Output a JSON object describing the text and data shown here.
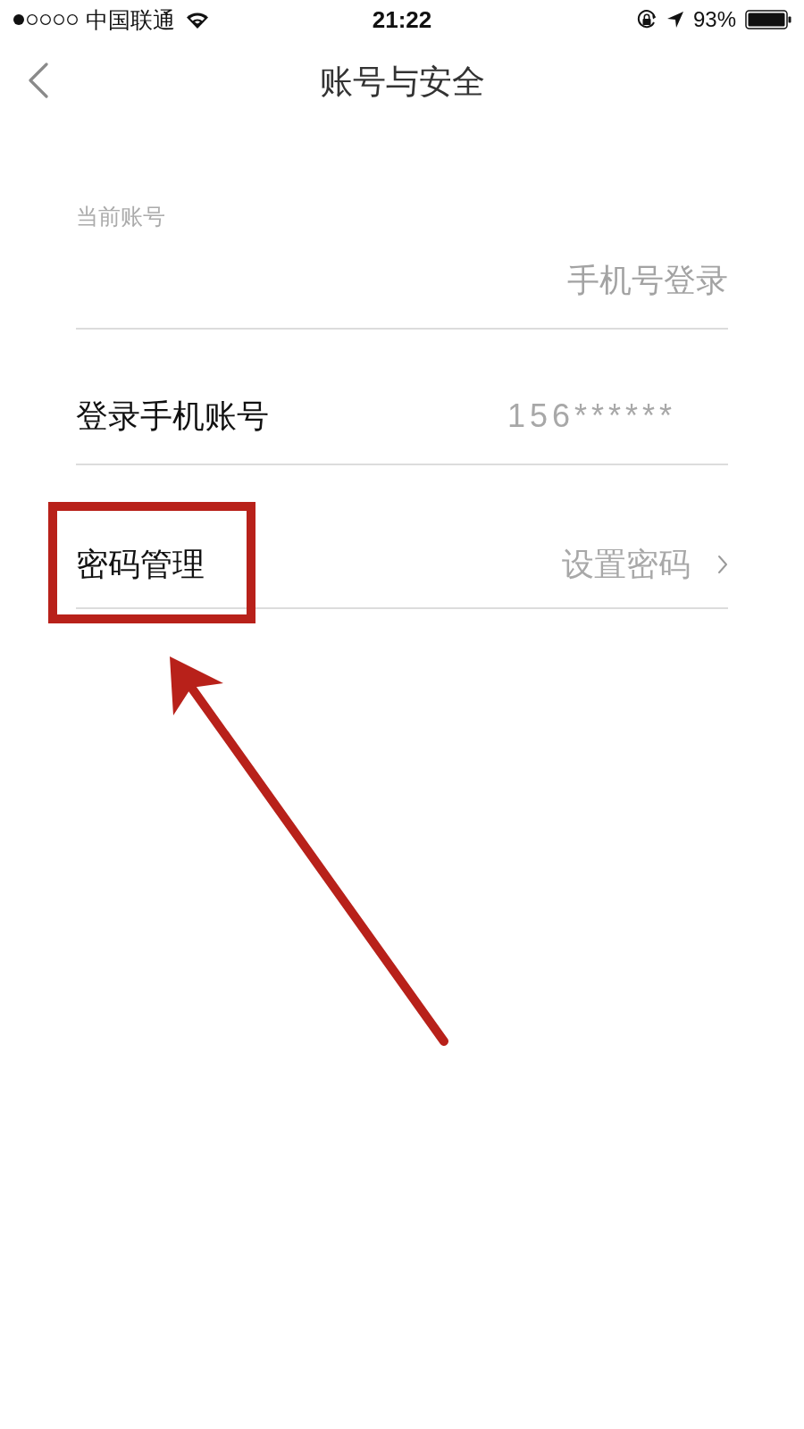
{
  "status_bar": {
    "carrier": "中国联通",
    "time": "21:22",
    "battery": "93%"
  },
  "nav": {
    "title": "账号与安全"
  },
  "current_account": {
    "label": "当前账号",
    "value": "手机号登录"
  },
  "rows": [
    {
      "kind": "info",
      "label": "登录手机账号",
      "value": "156******",
      "highlighted": false
    },
    {
      "kind": "link",
      "label": "密码管理",
      "value": "设置密码",
      "highlighted": true
    }
  ],
  "pointer_arrow": true
}
